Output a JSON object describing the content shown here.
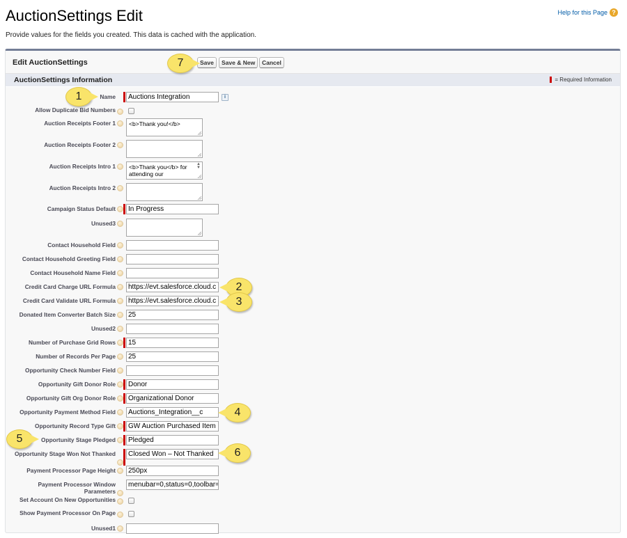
{
  "page": {
    "title": "AuctionSettings Edit",
    "intro": "Provide values for the fields you created. This data is cached with the application.",
    "help_link": "Help for this Page",
    "help_icon": "question-icon"
  },
  "panel": {
    "title": "Edit AuctionSettings",
    "buttons": {
      "save": "Save",
      "save_new": "Save & New",
      "cancel": "Cancel"
    },
    "section_title": "AuctionSettings Information",
    "required_legend": "= Required Information"
  },
  "fields": [
    {
      "label": "Name",
      "type": "text",
      "value": "Auctions Integration",
      "required": true,
      "info": "i"
    },
    {
      "label": "Allow Duplicate Bid Numbers",
      "type": "checkbox",
      "checked": false
    },
    {
      "label": "Auction Receipts Footer 1",
      "type": "textarea",
      "value": "<b>Thank you!</b>"
    },
    {
      "label": "Auction Receipts Footer 2",
      "type": "textarea",
      "value": ""
    },
    {
      "label": "Auction Receipts Intro 1",
      "type": "textarea",
      "value": "<b>Thank you</b> for attending our"
    },
    {
      "label": "Auction Receipts Intro 2",
      "type": "textarea",
      "value": ""
    },
    {
      "label": "Campaign Status Default",
      "type": "text",
      "value": "In Progress",
      "required": true
    },
    {
      "label": "Unused3",
      "type": "textarea",
      "value": ""
    },
    {
      "label": "Contact Household Field",
      "type": "text",
      "value": ""
    },
    {
      "label": "Contact Household Greeting Field",
      "type": "text",
      "value": ""
    },
    {
      "label": "Contact Household Name Field",
      "type": "text",
      "value": ""
    },
    {
      "label": "Credit Card Charge URL Formula",
      "type": "text",
      "value": "https://evt.salesforce.cloud.c"
    },
    {
      "label": "Credit Card Validate URL Formula",
      "type": "text",
      "value": "https://evt.salesforce.cloud.c"
    },
    {
      "label": "Donated Item Converter Batch Size",
      "type": "text",
      "value": "25"
    },
    {
      "label": "Unused2",
      "type": "text",
      "value": ""
    },
    {
      "label": "Number of Purchase Grid Rows",
      "type": "text",
      "value": "15",
      "required": true
    },
    {
      "label": "Number of Records Per Page",
      "type": "text",
      "value": "25"
    },
    {
      "label": "Opportunity Check Number Field",
      "type": "text",
      "value": ""
    },
    {
      "label": "Opportunity Gift Donor Role",
      "type": "text",
      "value": "Donor",
      "required": true
    },
    {
      "label": "Opportunity Gift Org Donor Role",
      "type": "text",
      "value": "Organizational Donor",
      "required": true
    },
    {
      "label": "Opportunity Payment Method Field",
      "type": "text",
      "value": "Auctions_Integration__c"
    },
    {
      "label": "Opportunity Record Type Gift",
      "type": "text",
      "value": "GW Auction Purchased Item",
      "required": true
    },
    {
      "label": "Opportunity Stage Pledged",
      "type": "text",
      "value": "Pledged",
      "required": true
    },
    {
      "label": "Opportunity Stage Won Not Thanked",
      "type": "text",
      "value": "Closed Won – Not Thanked",
      "required": true
    },
    {
      "label": "Payment Processor Page Height",
      "type": "text",
      "value": "250px"
    },
    {
      "label": "Payment Processor Window Parameters",
      "type": "text",
      "value": "menubar=0,status=0,toolbar="
    },
    {
      "label": "Set Account On New Opportunities",
      "type": "checkbox",
      "checked": false
    },
    {
      "label": "Show Payment Processor On Page",
      "type": "checkbox",
      "checked": false
    },
    {
      "label": "Unused1",
      "type": "text",
      "value": ""
    }
  ],
  "callouts": [
    "1",
    "2",
    "3",
    "4",
    "5",
    "6",
    "7"
  ],
  "colors": {
    "required": "#cc0000",
    "panel_top_border": "#747e96",
    "section_bar": "#e6e9f0",
    "link": "#015ba7",
    "callout": "#f9e46a"
  }
}
